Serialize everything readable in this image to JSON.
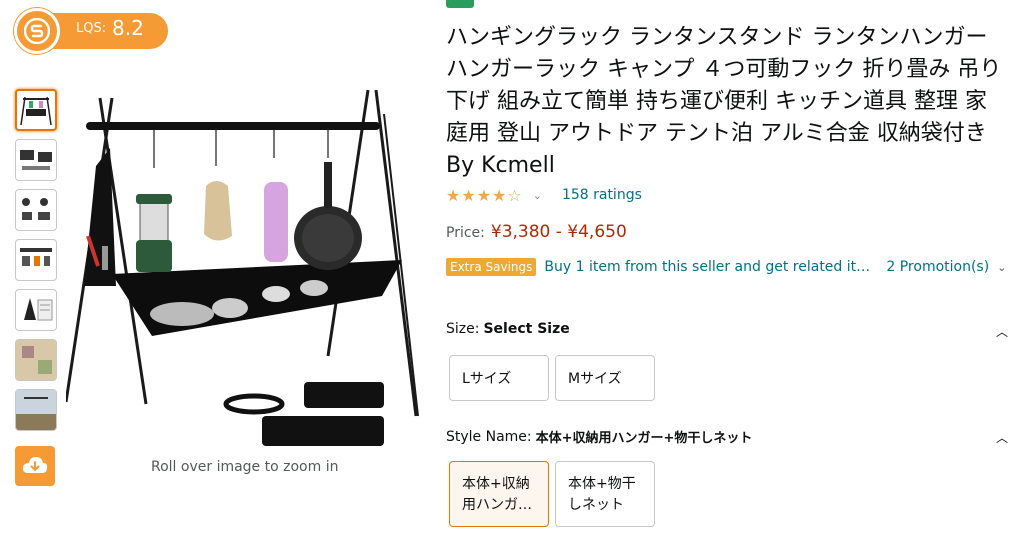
{
  "lqs": {
    "label": "LQS:",
    "value": "8.2"
  },
  "main": {
    "zoom_hint": "Roll over image to zoom in"
  },
  "product": {
    "title": "ハンギングラック ランタンスタンド ランタンハンガー ハンガーラック キャンプ ４つ可動フック 折り畳み 吊り下げ 組み立て簡単 持ち運び便利 キッチン道具 整理 家庭用 登山 アウトドア テント泊 アルミ合金 収納袋付き By Kcmell",
    "stars": "★★★★☆",
    "ratings": "158 ratings",
    "price_label": "Price:",
    "price": "¥3,380 - ¥4,650",
    "extra_badge": "Extra Savings",
    "promo_text": "Buy 1 item from this seller and get related items",
    "promo_count": "2 Promotion(s)"
  },
  "size": {
    "label": "Size:",
    "value": "Select Size",
    "options": [
      "Lサイズ",
      "Mサイズ"
    ]
  },
  "style": {
    "label": "Style Name:",
    "value": "本体+収納用ハンガー+物干しネット",
    "options": [
      "本体+収納用ハンガ…",
      "本体+物干しネット"
    ],
    "option_lines": [
      [
        "本体+収納",
        "用ハンガ…"
      ],
      [
        "本体+物干",
        "しネット"
      ]
    ]
  },
  "colors": {
    "accent": "#f59a34",
    "link": "#007185",
    "price": "#b12704",
    "selected_border": "#e77600"
  },
  "icons": [
    "lqs-logo-icon",
    "cloud-download-icon",
    "rating-chevron-icon",
    "promo-chevron-icon",
    "caret-up-icon"
  ]
}
